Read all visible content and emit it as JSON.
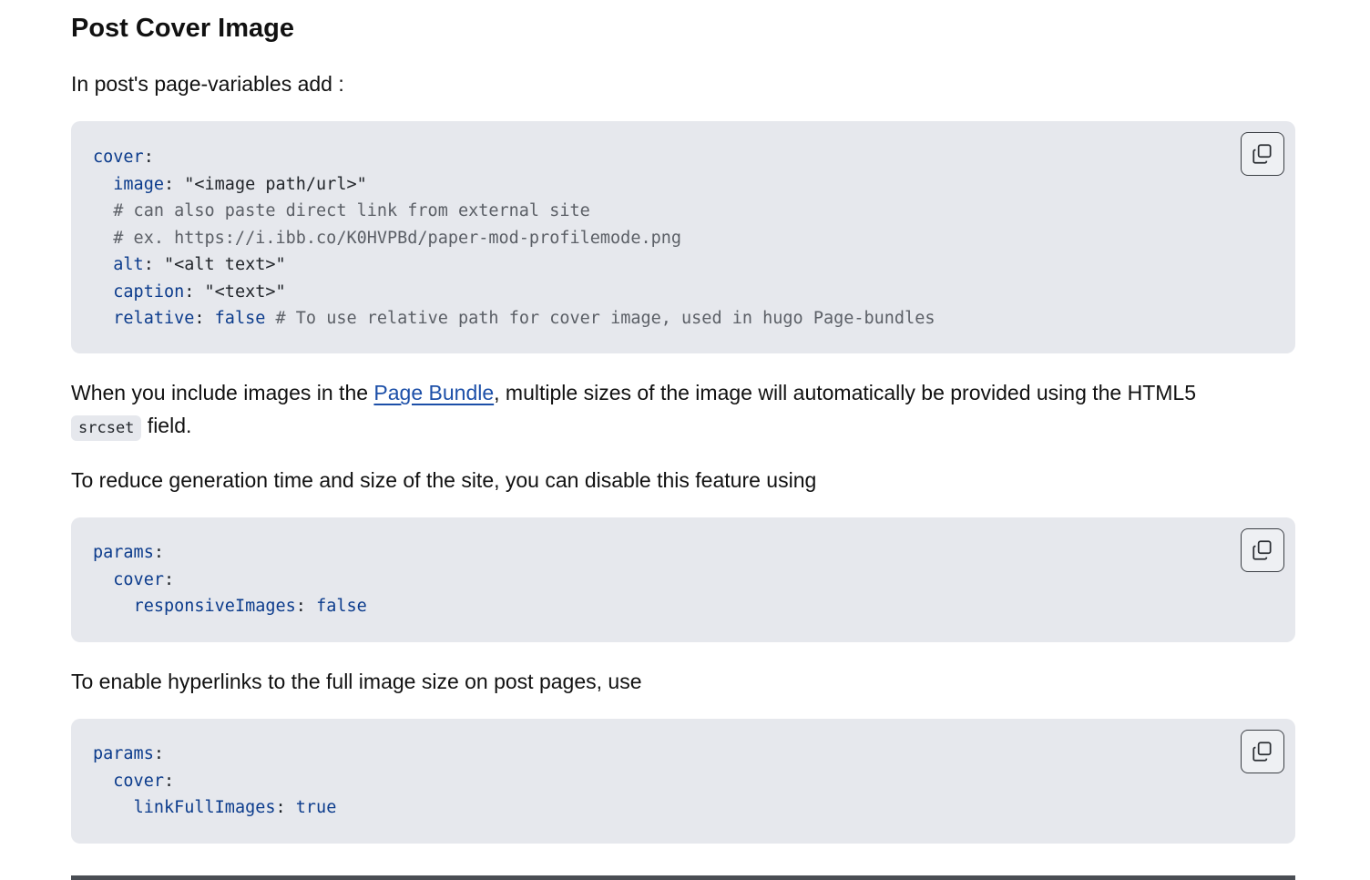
{
  "section": {
    "title": "Post Cover Image"
  },
  "para1": {
    "text": "In post's page-variables add :"
  },
  "code1": {
    "lines": [
      [
        {
          "t": "k",
          "v": "cover"
        },
        {
          "t": "s",
          "v": ":"
        }
      ],
      [
        {
          "t": "s",
          "v": "  "
        },
        {
          "t": "k",
          "v": "image"
        },
        {
          "t": "s",
          "v": ": \"<image path/url>\""
        }
      ],
      [
        {
          "t": "s",
          "v": "  "
        },
        {
          "t": "c",
          "v": "# can also paste direct link from external site"
        }
      ],
      [
        {
          "t": "s",
          "v": "  "
        },
        {
          "t": "c",
          "v": "# ex. https://i.ibb.co/K0HVPBd/paper-mod-profilemode.png"
        }
      ],
      [
        {
          "t": "s",
          "v": "  "
        },
        {
          "t": "k",
          "v": "alt"
        },
        {
          "t": "s",
          "v": ": \"<alt text>\""
        }
      ],
      [
        {
          "t": "s",
          "v": "  "
        },
        {
          "t": "k",
          "v": "caption"
        },
        {
          "t": "s",
          "v": ": \"<text>\""
        }
      ],
      [
        {
          "t": "s",
          "v": "  "
        },
        {
          "t": "k",
          "v": "relative"
        },
        {
          "t": "s",
          "v": ": "
        },
        {
          "t": "b",
          "v": "false"
        },
        {
          "t": "s",
          "v": " "
        },
        {
          "t": "c",
          "v": "# To use relative path for cover image, used in hugo Page-bundles"
        }
      ]
    ]
  },
  "para2": {
    "before": "When you include images in the ",
    "link": "Page Bundle",
    "after": ", multiple sizes of the image will automatically be provided using the HTML5",
    "code": "srcset",
    "end": " field."
  },
  "para3": {
    "text": "To reduce generation time and size of the site, you can disable this feature using"
  },
  "code2": {
    "lines": [
      [
        {
          "t": "k",
          "v": "params"
        },
        {
          "t": "s",
          "v": ":"
        }
      ],
      [
        {
          "t": "s",
          "v": "  "
        },
        {
          "t": "k",
          "v": "cover"
        },
        {
          "t": "s",
          "v": ":"
        }
      ],
      [
        {
          "t": "s",
          "v": "    "
        },
        {
          "t": "k",
          "v": "responsiveImages"
        },
        {
          "t": "s",
          "v": ": "
        },
        {
          "t": "b",
          "v": "false"
        }
      ]
    ]
  },
  "para4": {
    "text": "To enable hyperlinks to the full image size on post pages, use"
  },
  "code3": {
    "lines": [
      [
        {
          "t": "k",
          "v": "params"
        },
        {
          "t": "s",
          "v": ":"
        }
      ],
      [
        {
          "t": "s",
          "v": "  "
        },
        {
          "t": "k",
          "v": "cover"
        },
        {
          "t": "s",
          "v": ":"
        }
      ],
      [
        {
          "t": "s",
          "v": "    "
        },
        {
          "t": "k",
          "v": "linkFullImages"
        },
        {
          "t": "s",
          "v": ": "
        },
        {
          "t": "b",
          "v": "true"
        }
      ]
    ]
  },
  "icons": {
    "copy": "copy-icon"
  }
}
